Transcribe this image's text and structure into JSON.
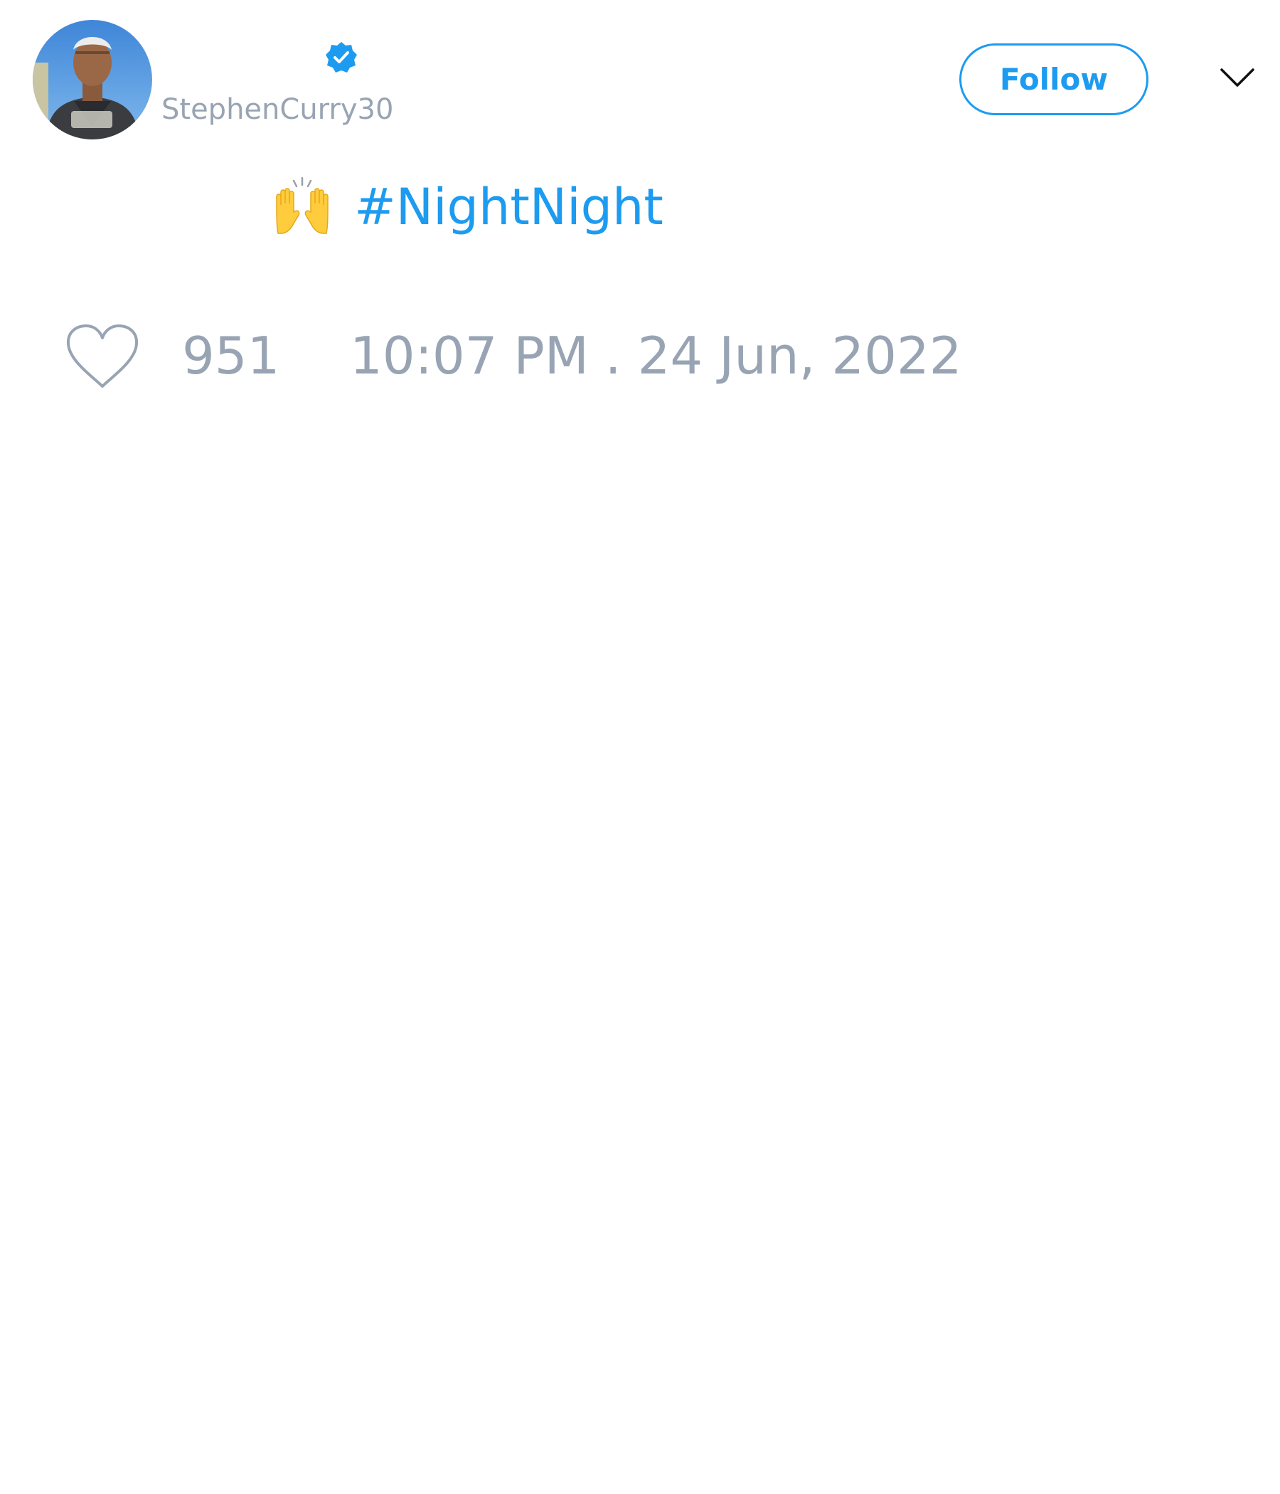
{
  "author": {
    "handle": "StephenCurry30",
    "verified": true,
    "avatar_icon": "profile-photo"
  },
  "header": {
    "follow_label": "Follow",
    "menu_icon": "chevron-down-icon"
  },
  "tweet": {
    "emoji": "raising-hands-emoji",
    "hashtag": "#NightNight"
  },
  "footer": {
    "like_icon": "heart-icon",
    "like_count": "951",
    "timestamp": "10:07 PM . 24 Jun, 2022"
  },
  "colors": {
    "accent": "#1d9bf0",
    "muted_text": "#98a4b3"
  }
}
